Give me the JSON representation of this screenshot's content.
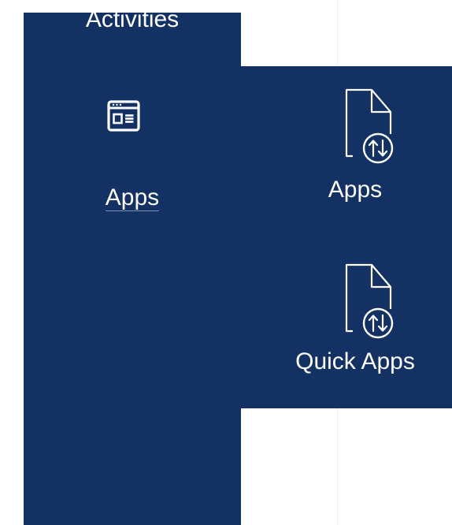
{
  "sidebar": {
    "items": [
      {
        "label": "Activities",
        "icon": "activities-icon"
      },
      {
        "label": "Apps",
        "icon": "app-window-icon"
      }
    ]
  },
  "flyout": {
    "items": [
      {
        "label": "Apps",
        "icon": "document-transfer-icon"
      },
      {
        "label": "Quick Apps",
        "icon": "document-transfer-icon"
      }
    ]
  },
  "colors": {
    "navy": "#143163",
    "text": "#ffffff",
    "background": "#ffffff"
  }
}
